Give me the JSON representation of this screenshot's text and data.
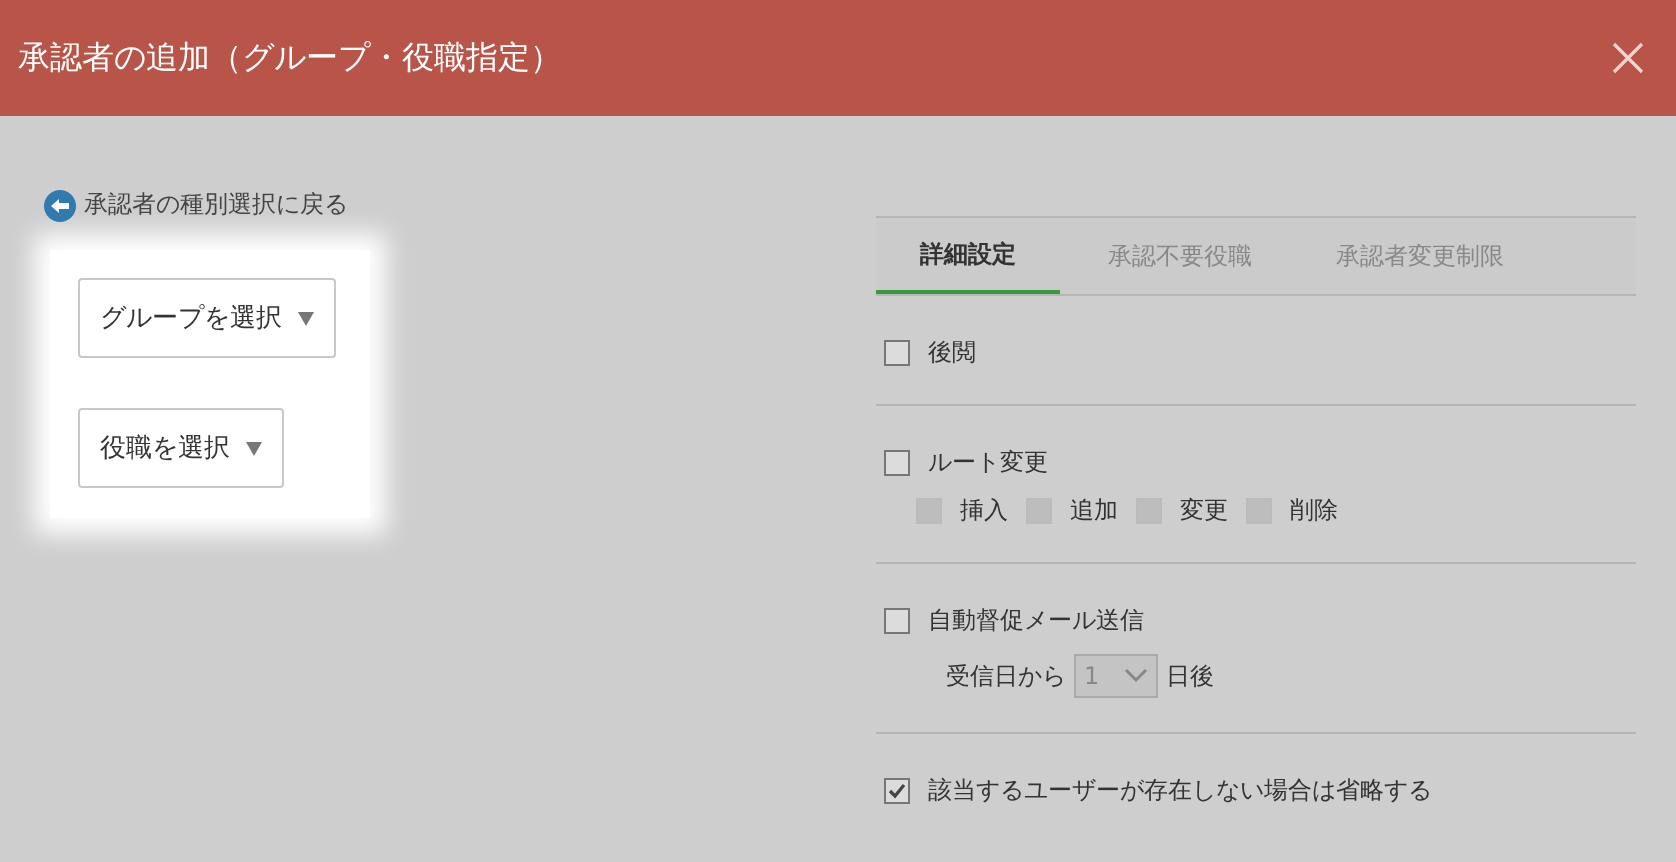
{
  "window": {
    "title": "承認者の追加（グループ・役職指定）"
  },
  "back_link": {
    "label": "承認者の種別選択に戻る"
  },
  "selectors": [
    {
      "label": "グループを選択"
    },
    {
      "label": "役職を選択"
    }
  ],
  "tabs": [
    {
      "label": "詳細設定",
      "selected": true
    },
    {
      "label": "承認不要役職",
      "selected": false
    },
    {
      "label": "承認者変更制限",
      "selected": false
    }
  ],
  "sections": [
    {
      "label": "後閲",
      "checked": false
    },
    {
      "label": "ルート変更",
      "checked": false,
      "options": [
        {
          "label": "挿入",
          "checked": false,
          "disabled": true
        },
        {
          "label": "追加",
          "checked": false,
          "disabled": true
        },
        {
          "label": "変更",
          "checked": false,
          "disabled": true
        },
        {
          "label": "削除",
          "checked": false,
          "disabled": true
        }
      ]
    },
    {
      "label": "自動督促メール送信",
      "checked": false,
      "delay": {
        "prefix": "受信日から",
        "value": "1",
        "suffix": "日後",
        "disabled": true
      }
    },
    {
      "label": "該当するユーザーが存在しない場合は省略する",
      "checked": true
    }
  ]
}
